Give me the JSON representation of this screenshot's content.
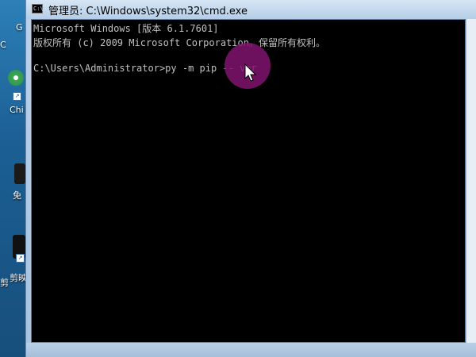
{
  "desktop": {
    "labels": {
      "g": "G",
      "c": "C",
      "chi": "Chi",
      "mian": "免",
      "jian": "剪映",
      "zhuo": "剪"
    }
  },
  "window": {
    "title": "管理员: C:\\Windows\\system32\\cmd.exe",
    "icon_text": "C:\\"
  },
  "console": {
    "lines": [
      "Microsoft Windows [版本 6.1.7601]",
      "版权所有 (c) 2009 Microsoft Corporation。保留所有权利。",
      "",
      "C:\\Users\\Administrator>py -m pip -- ver"
    ]
  },
  "colors": {
    "console_bg": "#000000",
    "console_fg": "#c0c0c0",
    "frame": "#b5cde6",
    "click_indicator": "#80146e"
  }
}
